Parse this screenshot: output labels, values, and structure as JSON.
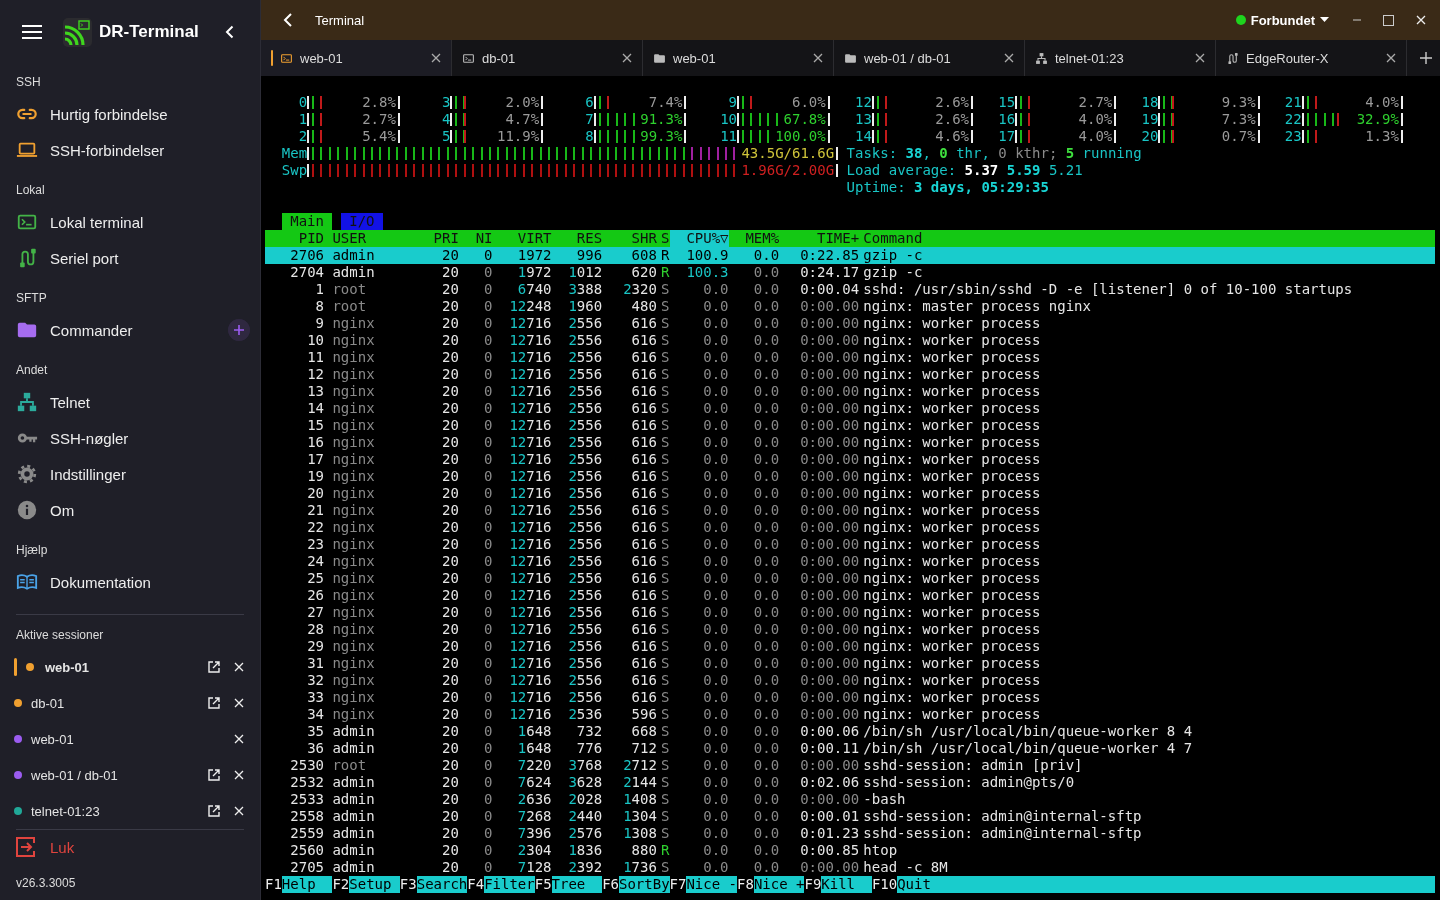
{
  "sidebar": {
    "app_name": "DR-Terminal",
    "sections": [
      {
        "title": "SSH",
        "items": [
          {
            "label": "Hurtig forbindelse",
            "kind": "link",
            "add_button": false
          },
          {
            "label": "SSH-forbindelser",
            "kind": "laptop",
            "add_button": false
          }
        ]
      },
      {
        "title": "Lokal",
        "items": [
          {
            "label": "Lokal terminal",
            "kind": "terminal",
            "add_button": false
          },
          {
            "label": "Seriel port",
            "kind": "cable",
            "add_button": false
          }
        ]
      },
      {
        "title": "SFTP",
        "items": [
          {
            "label": "Commander",
            "kind": "folder",
            "add_button": true
          }
        ]
      },
      {
        "title": "Andet",
        "items": [
          {
            "label": "Telnet",
            "kind": "network",
            "add_button": false
          },
          {
            "label": "SSH-nøgler",
            "kind": "key",
            "add_button": false
          },
          {
            "label": "Indstillinger",
            "kind": "gear",
            "add_button": false
          },
          {
            "label": "Om",
            "kind": "info",
            "add_button": false
          }
        ]
      },
      {
        "title": "Hjælp",
        "items": [
          {
            "label": "Dokumentation",
            "kind": "book",
            "add_button": false
          }
        ]
      }
    ],
    "sessions_title": "Aktive sessioner",
    "sessions": [
      {
        "label": "web-01",
        "color": "#f0a030",
        "selected": true,
        "popout": true
      },
      {
        "label": "db-01",
        "color": "#f0a030",
        "selected": false,
        "popout": true
      },
      {
        "label": "web-01",
        "color": "#9b5cf0",
        "selected": false,
        "popout": false
      },
      {
        "label": "web-01 / db-01",
        "color": "#9b5cf0",
        "selected": false,
        "popout": true
      },
      {
        "label": "telnet-01:23",
        "color": "#20a898",
        "selected": false,
        "popout": true
      }
    ],
    "quit": "Luk",
    "version": "v26.3.3005"
  },
  "topbar": {
    "title": "Terminal",
    "status": "Forbundet",
    "connected": true
  },
  "tabs": [
    {
      "label": "web-01",
      "kind": "terminal",
      "selected": true
    },
    {
      "label": "db-01",
      "kind": "terminal",
      "selected": false
    },
    {
      "label": "web-01",
      "kind": "folder",
      "selected": false
    },
    {
      "label": "web-01 / db-01",
      "kind": "folder",
      "selected": false
    },
    {
      "label": "telnet-01:23",
      "kind": "network",
      "selected": false
    },
    {
      "label": "EdgeRouter-X",
      "kind": "cable",
      "selected": false
    }
  ],
  "terminal": {
    "cpus": [
      {
        "label": "0",
        "level": 0.028,
        "reading": "2.8%"
      },
      {
        "label": "1",
        "level": 0.027,
        "reading": "2.7%"
      },
      {
        "label": "2",
        "level": 0.054,
        "reading": "5.4%"
      },
      {
        "label": "3",
        "level": 0.02,
        "reading": "2.0%"
      },
      {
        "label": "4",
        "level": 0.047,
        "reading": "4.7%"
      },
      {
        "label": "5",
        "level": 0.119,
        "reading": "11.9%"
      },
      {
        "label": "6",
        "level": 0.074,
        "reading": "7.4%"
      },
      {
        "label": "7",
        "level": 0.913,
        "reading": "91.3%"
      },
      {
        "label": "8",
        "level": 0.993,
        "reading": "99.3%"
      },
      {
        "label": "9",
        "level": 0.06,
        "reading": "6.0%"
      },
      {
        "label": "10",
        "level": 0.678,
        "reading": "67.8%"
      },
      {
        "label": "11",
        "level": 1.0,
        "reading": "100.0%"
      },
      {
        "label": "12",
        "level": 0.026,
        "reading": "2.6%"
      },
      {
        "label": "13",
        "level": 0.026,
        "reading": "2.6%"
      },
      {
        "label": "14",
        "level": 0.046,
        "reading": "4.6%"
      },
      {
        "label": "15",
        "level": 0.027,
        "reading": "2.7%"
      },
      {
        "label": "16",
        "level": 0.04,
        "reading": "4.0%"
      },
      {
        "label": "17",
        "level": 0.04,
        "reading": "4.0%"
      },
      {
        "label": "18",
        "level": 0.093,
        "reading": "9.3%"
      },
      {
        "label": "19",
        "level": 0.073,
        "reading": "7.3%"
      },
      {
        "label": "20",
        "level": 0.007,
        "reading": "0.7%"
      },
      {
        "label": "21",
        "level": 0.04,
        "reading": "4.0%"
      },
      {
        "label": "22",
        "level": 0.329,
        "reading": "32.9%"
      },
      {
        "label": "23",
        "level": 0.013,
        "reading": "1.3%"
      }
    ],
    "memory": [
      {
        "label": "Mem",
        "kind": "mem",
        "level": 0.9,
        "reading": "43.5G/61.6G"
      },
      {
        "label": "Swp",
        "kind": "swap",
        "level": 0.98,
        "reading": "1.96G/2.00G"
      }
    ],
    "info": [
      [
        {
          "text": "Tasks: ",
          "kind": "label"
        },
        {
          "text": "38",
          "kind": "strong"
        },
        {
          "text": ", ",
          "kind": "label"
        },
        {
          "text": "0",
          "kind": "good"
        },
        {
          "text": " thr, ",
          "kind": "label"
        },
        {
          "text": "0 kthr; ",
          "kind": "dim"
        },
        {
          "text": "5",
          "kind": "good"
        },
        {
          "text": " running",
          "kind": "label"
        }
      ],
      [
        {
          "text": "Load average: ",
          "kind": "label"
        },
        {
          "text": "5.37 ",
          "kind": "bright"
        },
        {
          "text": "5.59 ",
          "kind": "strong"
        },
        {
          "text": "5.21",
          "kind": "label"
        }
      ],
      [
        {
          "text": "Uptime: ",
          "kind": "label"
        },
        {
          "text": "3 days, 05:29:35",
          "kind": "strong"
        }
      ]
    ],
    "screen_tabs": [
      {
        "label": "Main",
        "selected": true
      },
      {
        "label": "I/O",
        "selected": false
      }
    ],
    "columns": [
      {
        "label": "PID",
        "sorted": false
      },
      {
        "label": "USER",
        "sorted": false
      },
      {
        "label": "PRI",
        "sorted": false
      },
      {
        "label": "NI",
        "sorted": false
      },
      {
        "label": "VIRT",
        "sorted": false
      },
      {
        "label": "RES",
        "sorted": false
      },
      {
        "label": "SHR",
        "sorted": false
      },
      {
        "label": "S",
        "sorted": false
      },
      {
        "label": "CPU%▽",
        "sorted": true
      },
      {
        "label": "MEM%",
        "sorted": false
      },
      {
        "label": "TIME+",
        "sorted": false
      },
      {
        "label": "Command",
        "sorted": false
      }
    ],
    "processes": [
      {
        "pid": "2706",
        "user": "admin",
        "current_user": true,
        "pri": "20",
        "ni": "0",
        "virt": "1972",
        "res": "996",
        "shr": "608",
        "s": "R",
        "running": true,
        "cpu": "100.9",
        "mem": "0.0",
        "time": "0:22.85",
        "command": "gzip -c",
        "selected": true
      },
      {
        "pid": "2704",
        "user": "admin",
        "current_user": true,
        "pri": "20",
        "ni": "0",
        "virt": "1972",
        "res": "1012",
        "shr": "620",
        "s": "R",
        "running": true,
        "cpu": "100.3",
        "mem": "0.0",
        "time": "0:24.17",
        "command": "gzip -c",
        "selected": false
      },
      {
        "pid": "1",
        "user": "root",
        "current_user": false,
        "pri": "20",
        "ni": "0",
        "virt": "6740",
        "res": "3388",
        "shr": "2320",
        "s": "S",
        "running": false,
        "cpu": "0.0",
        "mem": "0.0",
        "time": "0:00.04",
        "command": "sshd: /usr/sbin/sshd -D -e [listener] 0 of 10-100 startups",
        "selected": false
      },
      {
        "pid": "8",
        "user": "root",
        "current_user": false,
        "pri": "20",
        "ni": "0",
        "virt": "12248",
        "res": "1960",
        "shr": "480",
        "s": "S",
        "running": false,
        "cpu": "0.0",
        "mem": "0.0",
        "time": "0:00.00",
        "command": "nginx: master process nginx",
        "selected": false
      },
      {
        "pid": "9",
        "user": "nginx",
        "current_user": false,
        "pri": "20",
        "ni": "0",
        "virt": "12716",
        "res": "2556",
        "shr": "616",
        "s": "S",
        "running": false,
        "cpu": "0.0",
        "mem": "0.0",
        "time": "0:00.00",
        "command": "nginx: worker process",
        "selected": false
      },
      {
        "pid": "10",
        "user": "nginx",
        "current_user": false,
        "pri": "20",
        "ni": "0",
        "virt": "12716",
        "res": "2556",
        "shr": "616",
        "s": "S",
        "running": false,
        "cpu": "0.0",
        "mem": "0.0",
        "time": "0:00.00",
        "command": "nginx: worker process",
        "selected": false
      },
      {
        "pid": "11",
        "user": "nginx",
        "current_user": false,
        "pri": "20",
        "ni": "0",
        "virt": "12716",
        "res": "2556",
        "shr": "616",
        "s": "S",
        "running": false,
        "cpu": "0.0",
        "mem": "0.0",
        "time": "0:00.00",
        "command": "nginx: worker process",
        "selected": false
      },
      {
        "pid": "12",
        "user": "nginx",
        "current_user": false,
        "pri": "20",
        "ni": "0",
        "virt": "12716",
        "res": "2556",
        "shr": "616",
        "s": "S",
        "running": false,
        "cpu": "0.0",
        "mem": "0.0",
        "time": "0:00.00",
        "command": "nginx: worker process",
        "selected": false
      },
      {
        "pid": "13",
        "user": "nginx",
        "current_user": false,
        "pri": "20",
        "ni": "0",
        "virt": "12716",
        "res": "2556",
        "shr": "616",
        "s": "S",
        "running": false,
        "cpu": "0.0",
        "mem": "0.0",
        "time": "0:00.00",
        "command": "nginx: worker process",
        "selected": false
      },
      {
        "pid": "14",
        "user": "nginx",
        "current_user": false,
        "pri": "20",
        "ni": "0",
        "virt": "12716",
        "res": "2556",
        "shr": "616",
        "s": "S",
        "running": false,
        "cpu": "0.0",
        "mem": "0.0",
        "time": "0:00.00",
        "command": "nginx: worker process",
        "selected": false
      },
      {
        "pid": "15",
        "user": "nginx",
        "current_user": false,
        "pri": "20",
        "ni": "0",
        "virt": "12716",
        "res": "2556",
        "shr": "616",
        "s": "S",
        "running": false,
        "cpu": "0.0",
        "mem": "0.0",
        "time": "0:00.00",
        "command": "nginx: worker process",
        "selected": false
      },
      {
        "pid": "16",
        "user": "nginx",
        "current_user": false,
        "pri": "20",
        "ni": "0",
        "virt": "12716",
        "res": "2556",
        "shr": "616",
        "s": "S",
        "running": false,
        "cpu": "0.0",
        "mem": "0.0",
        "time": "0:00.00",
        "command": "nginx: worker process",
        "selected": false
      },
      {
        "pid": "17",
        "user": "nginx",
        "current_user": false,
        "pri": "20",
        "ni": "0",
        "virt": "12716",
        "res": "2556",
        "shr": "616",
        "s": "S",
        "running": false,
        "cpu": "0.0",
        "mem": "0.0",
        "time": "0:00.00",
        "command": "nginx: worker process",
        "selected": false
      },
      {
        "pid": "19",
        "user": "nginx",
        "current_user": false,
        "pri": "20",
        "ni": "0",
        "virt": "12716",
        "res": "2556",
        "shr": "616",
        "s": "S",
        "running": false,
        "cpu": "0.0",
        "mem": "0.0",
        "time": "0:00.00",
        "command": "nginx: worker process",
        "selected": false
      },
      {
        "pid": "20",
        "user": "nginx",
        "current_user": false,
        "pri": "20",
        "ni": "0",
        "virt": "12716",
        "res": "2556",
        "shr": "616",
        "s": "S",
        "running": false,
        "cpu": "0.0",
        "mem": "0.0",
        "time": "0:00.00",
        "command": "nginx: worker process",
        "selected": false
      },
      {
        "pid": "21",
        "user": "nginx",
        "current_user": false,
        "pri": "20",
        "ni": "0",
        "virt": "12716",
        "res": "2556",
        "shr": "616",
        "s": "S",
        "running": false,
        "cpu": "0.0",
        "mem": "0.0",
        "time": "0:00.00",
        "command": "nginx: worker process",
        "selected": false
      },
      {
        "pid": "22",
        "user": "nginx",
        "current_user": false,
        "pri": "20",
        "ni": "0",
        "virt": "12716",
        "res": "2556",
        "shr": "616",
        "s": "S",
        "running": false,
        "cpu": "0.0",
        "mem": "0.0",
        "time": "0:00.00",
        "command": "nginx: worker process",
        "selected": false
      },
      {
        "pid": "23",
        "user": "nginx",
        "current_user": false,
        "pri": "20",
        "ni": "0",
        "virt": "12716",
        "res": "2556",
        "shr": "616",
        "s": "S",
        "running": false,
        "cpu": "0.0",
        "mem": "0.0",
        "time": "0:00.00",
        "command": "nginx: worker process",
        "selected": false
      },
      {
        "pid": "24",
        "user": "nginx",
        "current_user": false,
        "pri": "20",
        "ni": "0",
        "virt": "12716",
        "res": "2556",
        "shr": "616",
        "s": "S",
        "running": false,
        "cpu": "0.0",
        "mem": "0.0",
        "time": "0:00.00",
        "command": "nginx: worker process",
        "selected": false
      },
      {
        "pid": "25",
        "user": "nginx",
        "current_user": false,
        "pri": "20",
        "ni": "0",
        "virt": "12716",
        "res": "2556",
        "shr": "616",
        "s": "S",
        "running": false,
        "cpu": "0.0",
        "mem": "0.0",
        "time": "0:00.00",
        "command": "nginx: worker process",
        "selected": false
      },
      {
        "pid": "26",
        "user": "nginx",
        "current_user": false,
        "pri": "20",
        "ni": "0",
        "virt": "12716",
        "res": "2556",
        "shr": "616",
        "s": "S",
        "running": false,
        "cpu": "0.0",
        "mem": "0.0",
        "time": "0:00.00",
        "command": "nginx: worker process",
        "selected": false
      },
      {
        "pid": "27",
        "user": "nginx",
        "current_user": false,
        "pri": "20",
        "ni": "0",
        "virt": "12716",
        "res": "2556",
        "shr": "616",
        "s": "S",
        "running": false,
        "cpu": "0.0",
        "mem": "0.0",
        "time": "0:00.00",
        "command": "nginx: worker process",
        "selected": false
      },
      {
        "pid": "28",
        "user": "nginx",
        "current_user": false,
        "pri": "20",
        "ni": "0",
        "virt": "12716",
        "res": "2556",
        "shr": "616",
        "s": "S",
        "running": false,
        "cpu": "0.0",
        "mem": "0.0",
        "time": "0:00.00",
        "command": "nginx: worker process",
        "selected": false
      },
      {
        "pid": "29",
        "user": "nginx",
        "current_user": false,
        "pri": "20",
        "ni": "0",
        "virt": "12716",
        "res": "2556",
        "shr": "616",
        "s": "S",
        "running": false,
        "cpu": "0.0",
        "mem": "0.0",
        "time": "0:00.00",
        "command": "nginx: worker process",
        "selected": false
      },
      {
        "pid": "31",
        "user": "nginx",
        "current_user": false,
        "pri": "20",
        "ni": "0",
        "virt": "12716",
        "res": "2556",
        "shr": "616",
        "s": "S",
        "running": false,
        "cpu": "0.0",
        "mem": "0.0",
        "time": "0:00.00",
        "command": "nginx: worker process",
        "selected": false
      },
      {
        "pid": "32",
        "user": "nginx",
        "current_user": false,
        "pri": "20",
        "ni": "0",
        "virt": "12716",
        "res": "2556",
        "shr": "616",
        "s": "S",
        "running": false,
        "cpu": "0.0",
        "mem": "0.0",
        "time": "0:00.00",
        "command": "nginx: worker process",
        "selected": false
      },
      {
        "pid": "33",
        "user": "nginx",
        "current_user": false,
        "pri": "20",
        "ni": "0",
        "virt": "12716",
        "res": "2556",
        "shr": "616",
        "s": "S",
        "running": false,
        "cpu": "0.0",
        "mem": "0.0",
        "time": "0:00.00",
        "command": "nginx: worker process",
        "selected": false
      },
      {
        "pid": "34",
        "user": "nginx",
        "current_user": false,
        "pri": "20",
        "ni": "0",
        "virt": "12716",
        "res": "2536",
        "shr": "596",
        "s": "S",
        "running": false,
        "cpu": "0.0",
        "mem": "0.0",
        "time": "0:00.00",
        "command": "nginx: worker process",
        "selected": false
      },
      {
        "pid": "35",
        "user": "admin",
        "current_user": true,
        "pri": "20",
        "ni": "0",
        "virt": "1648",
        "res": "732",
        "shr": "668",
        "s": "S",
        "running": false,
        "cpu": "0.0",
        "mem": "0.0",
        "time": "0:00.06",
        "command": "/bin/sh /usr/local/bin/queue-worker 8 4",
        "selected": false
      },
      {
        "pid": "36",
        "user": "admin",
        "current_user": true,
        "pri": "20",
        "ni": "0",
        "virt": "1648",
        "res": "776",
        "shr": "712",
        "s": "S",
        "running": false,
        "cpu": "0.0",
        "mem": "0.0",
        "time": "0:00.11",
        "command": "/bin/sh /usr/local/bin/queue-worker 4 7",
        "selected": false
      },
      {
        "pid": "2530",
        "user": "root",
        "current_user": false,
        "pri": "20",
        "ni": "0",
        "virt": "7220",
        "res": "3768",
        "shr": "2712",
        "s": "S",
        "running": false,
        "cpu": "0.0",
        "mem": "0.0",
        "time": "0:00.00",
        "command": "sshd-session: admin [priv]",
        "selected": false
      },
      {
        "pid": "2532",
        "user": "admin",
        "current_user": true,
        "pri": "20",
        "ni": "0",
        "virt": "7624",
        "res": "3628",
        "shr": "2144",
        "s": "S",
        "running": false,
        "cpu": "0.0",
        "mem": "0.0",
        "time": "0:02.06",
        "command": "sshd-session: admin@pts/0",
        "selected": false
      },
      {
        "pid": "2533",
        "user": "admin",
        "current_user": true,
        "pri": "20",
        "ni": "0",
        "virt": "2636",
        "res": "2028",
        "shr": "1408",
        "s": "S",
        "running": false,
        "cpu": "0.0",
        "mem": "0.0",
        "time": "0:00.00",
        "command": "-bash",
        "selected": false
      },
      {
        "pid": "2558",
        "user": "admin",
        "current_user": true,
        "pri": "20",
        "ni": "0",
        "virt": "7268",
        "res": "2440",
        "shr": "1304",
        "s": "S",
        "running": false,
        "cpu": "0.0",
        "mem": "0.0",
        "time": "0:00.01",
        "command": "sshd-session: admin@internal-sftp",
        "selected": false
      },
      {
        "pid": "2559",
        "user": "admin",
        "current_user": true,
        "pri": "20",
        "ni": "0",
        "virt": "7396",
        "res": "2576",
        "shr": "1308",
        "s": "S",
        "running": false,
        "cpu": "0.0",
        "mem": "0.0",
        "time": "0:01.23",
        "command": "sshd-session: admin@internal-sftp",
        "selected": false
      },
      {
        "pid": "2560",
        "user": "admin",
        "current_user": true,
        "pri": "20",
        "ni": "0",
        "virt": "2304",
        "res": "1836",
        "shr": "880",
        "s": "R",
        "running": true,
        "cpu": "0.0",
        "mem": "0.0",
        "time": "0:00.85",
        "command": "htop",
        "selected": false
      },
      {
        "pid": "2705",
        "user": "admin",
        "current_user": true,
        "pri": "20",
        "ni": "0",
        "virt": "7128",
        "res": "2392",
        "shr": "1736",
        "s": "S",
        "running": false,
        "cpu": "0.0",
        "mem": "0.0",
        "time": "0:00.00",
        "command": "head -c 8M",
        "selected": false
      }
    ],
    "function_keys": [
      {
        "key": "F1",
        "label": "Help"
      },
      {
        "key": "F2",
        "label": "Setup"
      },
      {
        "key": "F3",
        "label": "Search"
      },
      {
        "key": "F4",
        "label": "Filter"
      },
      {
        "key": "F5",
        "label": "Tree"
      },
      {
        "key": "F6",
        "label": "SortBy"
      },
      {
        "key": "F7",
        "label": "Nice -"
      },
      {
        "key": "F8",
        "label": "Nice +"
      },
      {
        "key": "F9",
        "label": "Kill"
      },
      {
        "key": "F10",
        "label": "Quit"
      }
    ]
  }
}
